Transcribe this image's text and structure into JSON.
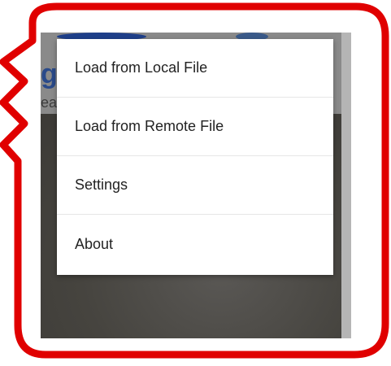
{
  "menu": {
    "items": [
      {
        "label": "Load from Local File"
      },
      {
        "label": "Load from Remote File"
      },
      {
        "label": "Settings"
      },
      {
        "label": "About"
      }
    ]
  },
  "background": {
    "logo_text": "g",
    "sub_text": "ea"
  },
  "colors": {
    "callout_border": "#e00000",
    "menu_bg": "#ffffff",
    "menu_text": "#222222",
    "screen_dark": "#4d4b48",
    "appbar_gray": "#8a8a8a"
  }
}
